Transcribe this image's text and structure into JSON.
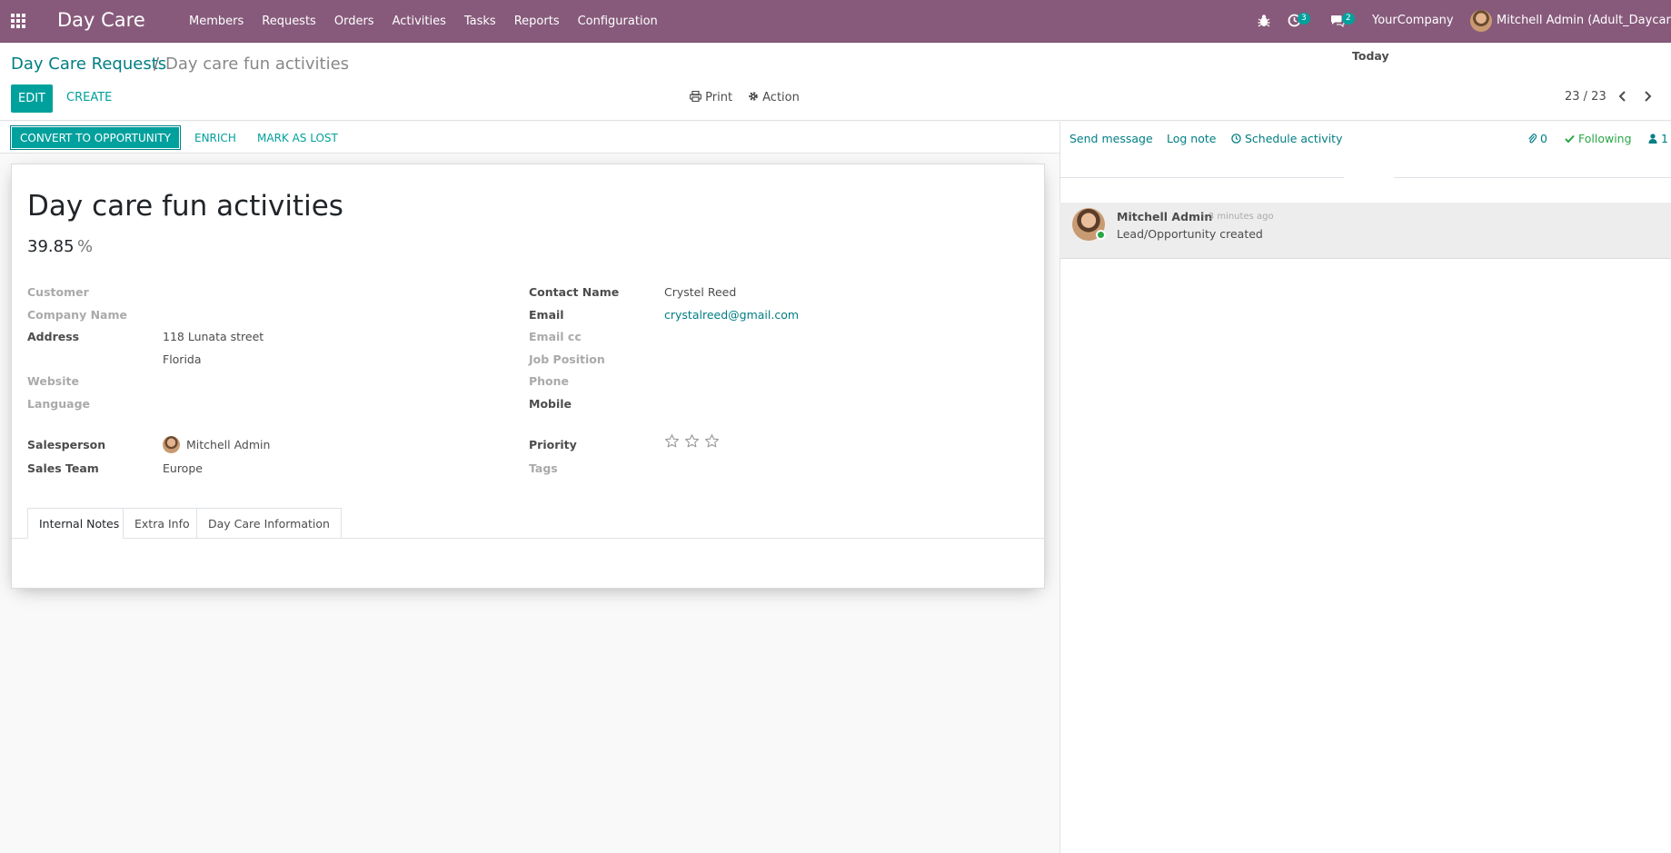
{
  "navbar": {
    "brand": "Day Care",
    "menu": [
      "Members",
      "Requests",
      "Orders",
      "Activities",
      "Tasks",
      "Reports",
      "Configuration"
    ],
    "activity_count": "3",
    "message_count": "2",
    "company": "YourCompany",
    "user": "Mitchell Admin (Adult_Daycare)"
  },
  "breadcrumb": {
    "parent": "Day Care Requests",
    "separator": "/",
    "current": "Day care fun activities"
  },
  "toolbar": {
    "edit_label": "EDIT",
    "create_label": "CREATE",
    "print_label": "Print",
    "action_label": "Action",
    "pager": "23 / 23"
  },
  "statusbar": {
    "convert_label": "CONVERT TO OPPORTUNITY",
    "enrich_label": "ENRICH",
    "lost_label": "MARK AS LOST"
  },
  "form": {
    "title": "Day care fun activities",
    "probability": "39.85",
    "probability_unit": "%",
    "left": {
      "customer_label": "Customer",
      "company_label": "Company Name",
      "address_label": "Address",
      "address_line1": "118 Lunata street",
      "address_line2": "Florida",
      "website_label": "Website",
      "language_label": "Language",
      "salesperson_label": "Salesperson",
      "salesperson": "Mitchell Admin",
      "team_label": "Sales Team",
      "team": "Europe"
    },
    "right": {
      "contact_label": "Contact Name",
      "contact": "Crystel Reed",
      "email_label": "Email",
      "email": "crystalreed@gmail.com",
      "email_cc_label": "Email cc",
      "job_label": "Job Position",
      "phone_label": "Phone",
      "mobile_label": "Mobile",
      "priority_label": "Priority",
      "priority_stars": 0,
      "priority_max": 3,
      "tags_label": "Tags"
    },
    "tabs": [
      "Internal Notes",
      "Extra Info",
      "Day Care Information"
    ]
  },
  "chatter": {
    "send_message": "Send message",
    "log_note": "Log note",
    "schedule_activity": "Schedule activity",
    "attachments": "0",
    "following": "Following",
    "followers": "1",
    "day_label": "Today",
    "messages": [
      {
        "author": "Mitchell Admin",
        "date": "- 3 minutes ago",
        "body": "Lead/Opportunity created"
      }
    ]
  },
  "colors": {
    "navbar": "#875a7b",
    "primary": "#00a09d",
    "link": "#017e84",
    "success": "#28a745"
  }
}
